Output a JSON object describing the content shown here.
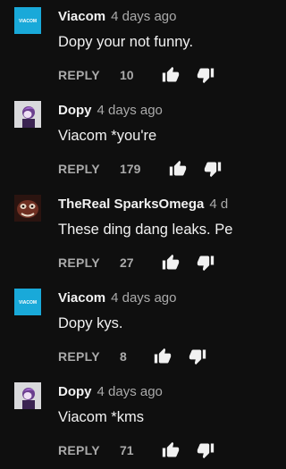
{
  "comments": [
    {
      "author": "Viacom",
      "time": "4 days ago",
      "text": "Dopy your not funny.",
      "reply_label": "REPLY",
      "likes": "10",
      "avatar": "viacom-logo",
      "avatar_text": "VIACOM"
    },
    {
      "author": "Dopy",
      "time": "4 days ago",
      "text": "Viacom *you're",
      "reply_label": "REPLY",
      "likes": "179",
      "avatar": "dopy-avatar"
    },
    {
      "author": "TheReal SparksOmega",
      "time": "4 d",
      "text": "These ding dang leaks. Pe",
      "reply_label": "REPLY",
      "likes": "27",
      "avatar": "sparks-avatar"
    },
    {
      "author": "Viacom",
      "time": "4 days ago",
      "text": "Dopy kys.",
      "reply_label": "REPLY",
      "likes": "8",
      "avatar": "viacom-logo",
      "avatar_text": "VIACOM"
    },
    {
      "author": "Dopy",
      "time": "4 days ago",
      "text": "Viacom *kms",
      "reply_label": "REPLY",
      "likes": "71",
      "avatar": "dopy-avatar"
    }
  ],
  "colors": {
    "background": "#0f0f0f",
    "text": "#f1f1f1",
    "secondary": "#aaaaaa",
    "viacom_avatar": "#19a9d9"
  }
}
